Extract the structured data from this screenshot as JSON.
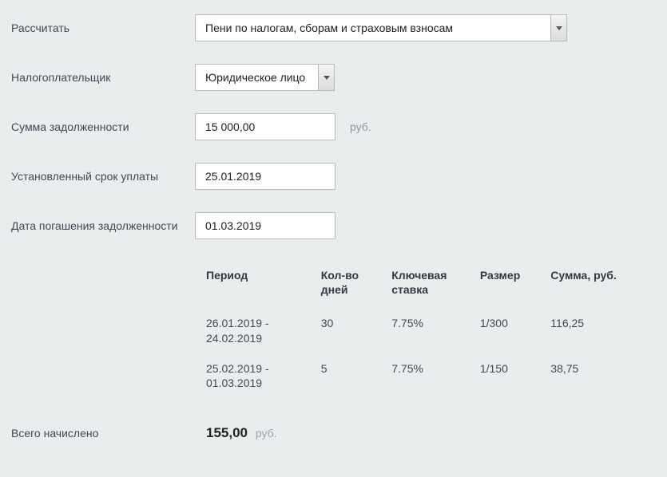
{
  "form": {
    "calculate": {
      "label": "Рассчитать",
      "value": "Пени по налогам, сборам и страховым взносам"
    },
    "taxpayer": {
      "label": "Налогоплательщик",
      "value": "Юридическое лицо"
    },
    "debt_amount": {
      "label": "Сумма задолженности",
      "value": "15 000,00",
      "unit": "руб."
    },
    "due_date": {
      "label": "Установленный срок уплаты",
      "value": "25.01.2019"
    },
    "payoff_date": {
      "label": "Дата погашения задолженности",
      "value": "01.03.2019"
    }
  },
  "table": {
    "headers": {
      "period": "Период",
      "days": "Кол-во дней",
      "rate": "Ключевая ставка",
      "size": "Размер",
      "sum": "Сумма, руб."
    },
    "rows": [
      {
        "period": "26.01.2019 - 24.02.2019",
        "days": "30",
        "rate": "7.75%",
        "size": "1/300",
        "sum": "116,25"
      },
      {
        "period": "25.02.2019 - 01.03.2019",
        "days": "5",
        "rate": "7.75%",
        "size": "1/150",
        "sum": "38,75"
      }
    ]
  },
  "total": {
    "label": "Всего начислено",
    "value": "155,00",
    "unit": "руб."
  }
}
